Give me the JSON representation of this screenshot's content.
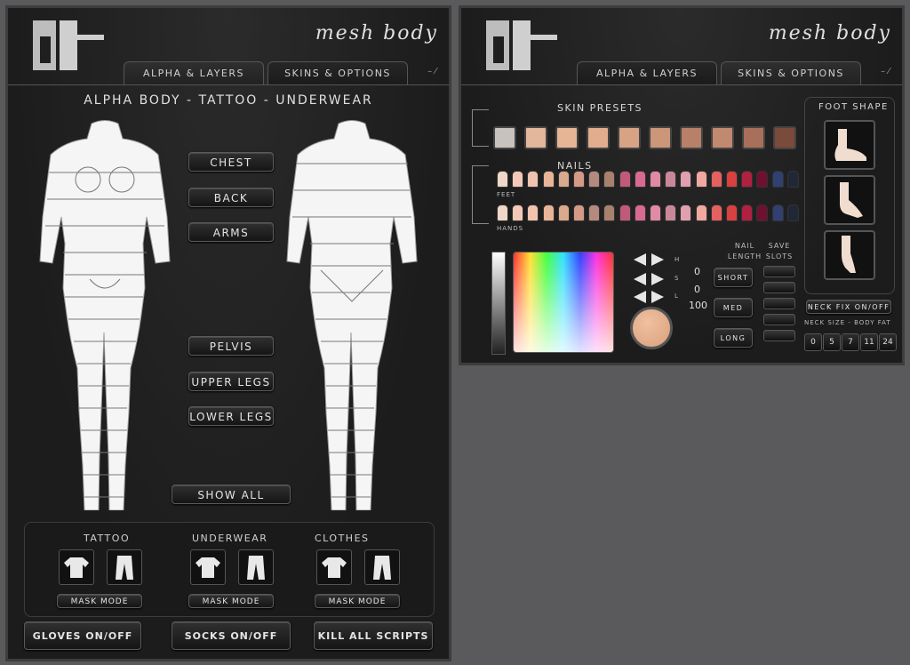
{
  "left": {
    "script_title": "mesh body",
    "tabs": [
      "ALPHA & LAYERS",
      "SKINS & OPTIONS"
    ],
    "minimize": "– ⁄",
    "heading": "ALPHA BODY - TATTOO - UNDERWEAR",
    "region_buttons": {
      "chest": "CHEST",
      "back": "BACK",
      "arms": "ARMS",
      "pelvis": "PELVIS",
      "upper_legs": "UPPER LEGS",
      "lower_legs": "LOWER LEGS",
      "show_all": "SHOW ALL"
    },
    "layers": [
      {
        "label": "TATTOO",
        "mask": "MASK MODE"
      },
      {
        "label": "UNDERWEAR",
        "mask": "MASK MODE"
      },
      {
        "label": "CLOTHES",
        "mask": "MASK MODE"
      }
    ],
    "bottom_buttons": [
      "GLOVES ON/OFF",
      "SOCKS ON/OFF",
      "KILL ALL SCRIPTS"
    ]
  },
  "right": {
    "script_title": "mesh body",
    "tabs": [
      "ALPHA & LAYERS",
      "SKINS & OPTIONS"
    ],
    "minimize": "– ⁄",
    "skin_presets_label": "SKIN PRESETS",
    "skin_presets": [
      "#c7c2be",
      "#e2b79c",
      "#e6b596",
      "#e1ad8e",
      "#d8a285",
      "#cc9679",
      "#b88069",
      "#c18a70",
      "#a8705a",
      "#7a4a3a"
    ],
    "nails_label": "NAILS",
    "feet_label": "FEET",
    "hands_label": "HANDS",
    "nail_colors": [
      "#f0d7c8",
      "#f5c9b8",
      "#efc3ae",
      "#e8b598",
      "#d9a98e",
      "#d49a86",
      "#b58a7e",
      "#a7806e",
      "#c05a7a",
      "#d86a92",
      "#e08aa6",
      "#c9889a",
      "#e0a0b0",
      "#f0a8a0",
      "#e56060",
      "#d94040",
      "#b02040",
      "#701030",
      "#304070",
      "#202838"
    ],
    "foot_shape_label": "FOOT SHAPE",
    "hsl_labels": [
      "H",
      "S",
      "L"
    ],
    "hsl_values": [
      "0",
      "0",
      "100"
    ],
    "preview_color": "#d9a07c",
    "nail_length_label": "NAIL LENGTH",
    "nail_length_buttons": [
      "SHORT",
      "MED",
      "LONG"
    ],
    "save_slots_label": "SAVE SLOTS",
    "neck_fix": "NECK FIX ON/OFF",
    "neck_size_label": "NECK SIZE - BODY FAT",
    "neck_sizes": [
      "0",
      "5",
      "7",
      "11",
      "24"
    ]
  }
}
